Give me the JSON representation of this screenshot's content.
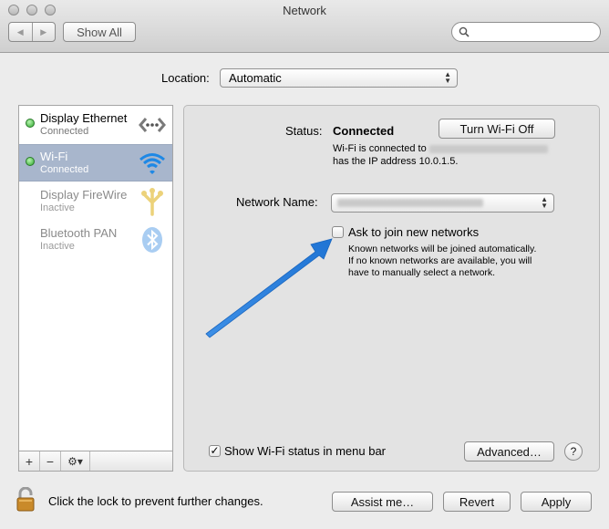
{
  "window": {
    "title": "Network"
  },
  "toolbar": {
    "back_glyph": "◀",
    "forward_glyph": "▶",
    "show_all_label": "Show All",
    "search_placeholder": ""
  },
  "location": {
    "label": "Location:",
    "value": "Automatic"
  },
  "services": [
    {
      "name": "Display Ethernet",
      "state": "Connected",
      "status_color": "#3fbf3f",
      "icon": "ethernet-icon",
      "selected": false
    },
    {
      "name": "Wi-Fi",
      "state": "Connected",
      "status_color": "#3fbf3f",
      "icon": "wifi-icon",
      "selected": true
    },
    {
      "name": "Display FireWire",
      "state": "Inactive",
      "status_color": "none",
      "icon": "firewire-icon",
      "selected": false
    },
    {
      "name": "Bluetooth PAN",
      "state": "Inactive",
      "status_color": "none",
      "icon": "bluetooth-icon",
      "selected": false
    }
  ],
  "sidebar_controls": {
    "add": "+",
    "remove": "−",
    "gear": "⚙▾"
  },
  "detail": {
    "status_label": "Status:",
    "status_value": "Connected",
    "turn_off_label": "Turn Wi-Fi Off",
    "connection_info_prefix": "Wi-Fi is connected to",
    "connection_info_line2": "has the IP address 10.0.1.5.",
    "network_name_label": "Network Name:",
    "network_name_value": "",
    "ask_join_label": "Ask to join new networks",
    "ask_join_checked": false,
    "ask_join_help": [
      "Known networks will be joined automatically.",
      "If no known networks are available, you will",
      "have to manually select a network."
    ],
    "show_status_label": "Show Wi-Fi status in menu bar",
    "show_status_checked": true,
    "advanced_label": "Advanced…",
    "help_label": "?"
  },
  "footer": {
    "lock_text": "Click the lock to prevent further changes.",
    "assist_label": "Assist me…",
    "revert_label": "Revert",
    "apply_label": "Apply"
  },
  "colors": {
    "selected_row": "#a8b6cc",
    "annotation_arrow": "#2c88e0"
  }
}
